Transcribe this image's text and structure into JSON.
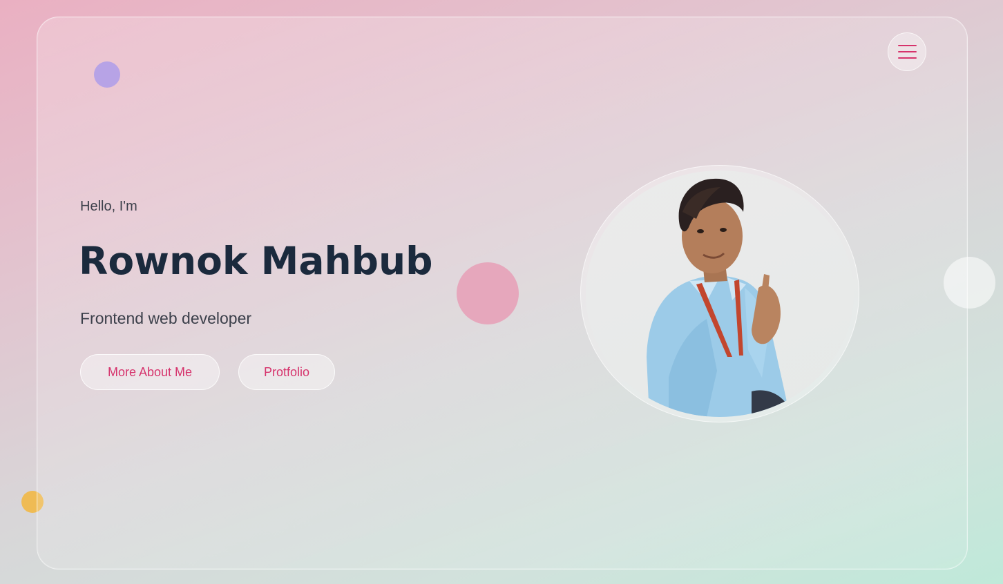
{
  "hero": {
    "greeting": "Hello, I'm",
    "name": "Rownok Mahbub",
    "role": "Frontend web developer"
  },
  "buttons": {
    "about_label": "More About Me",
    "portfolio_label": "Protfolio"
  },
  "menu": {
    "icon": "hamburger-icon"
  },
  "colors": {
    "accent": "#d6336c",
    "heading": "#1b2a3d",
    "text": "#3b3f4a",
    "blob_purple": "#b7a3e6",
    "blob_pink": "#e6a7bc",
    "blob_yellow": "#efbb54"
  }
}
